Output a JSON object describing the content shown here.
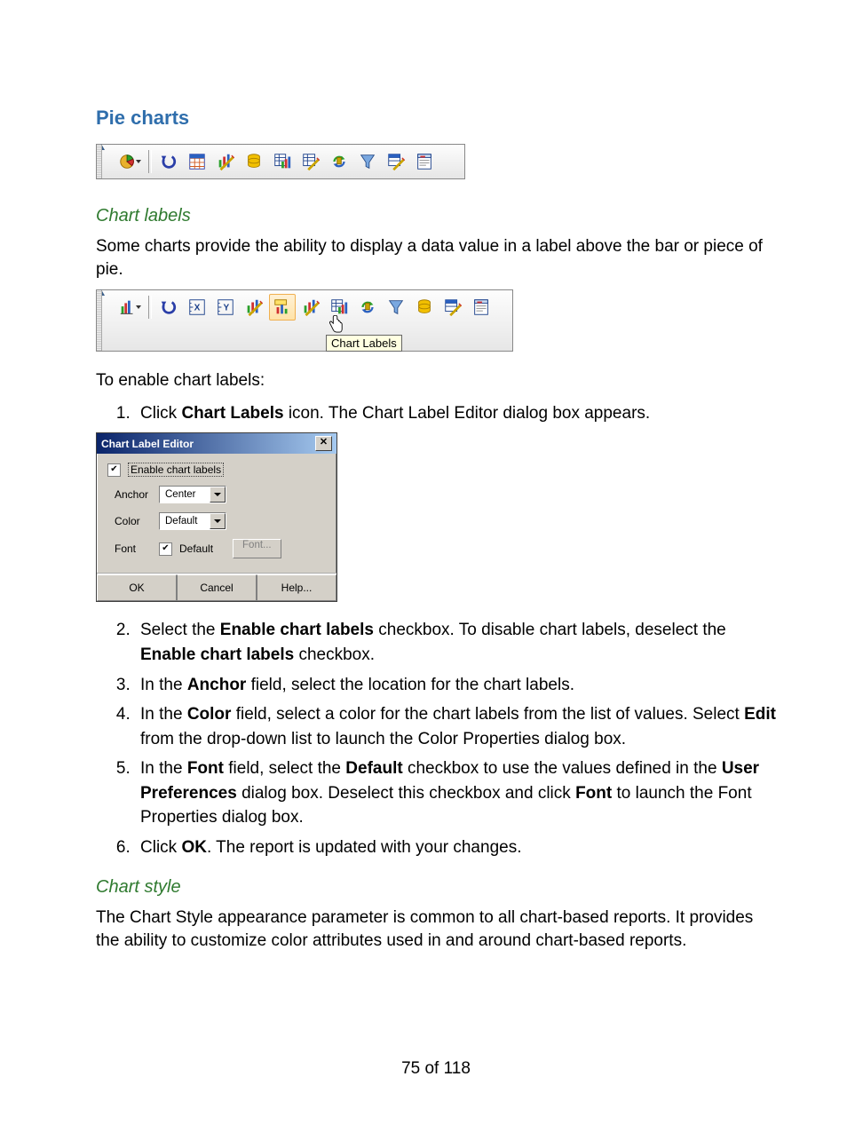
{
  "heading": "Pie charts",
  "sub_labels": "Chart labels",
  "para_labels_intro": "Some charts provide the ability to display a data value in a label above the bar or piece of pie.",
  "para_enable_labels": "To enable chart labels:",
  "tb1": {
    "items": [
      "pie-chart-icon",
      "undo-icon",
      "table-grid-icon",
      "graph-edit-icon",
      "database-icon",
      "data-grid-icon",
      "data-edit-icon",
      "refresh-icon",
      "filter-icon",
      "table-edit-icon",
      "page-layout-icon"
    ]
  },
  "tb2": {
    "items": [
      "bar-chart-icon",
      "undo-icon",
      "axis-x-icon",
      "axis-y-icon",
      "graph-edit-icon",
      "chart-labels-icon",
      "graph-edit2-icon",
      "data-grid-icon",
      "refresh-icon",
      "filter-icon",
      "database-icon",
      "table-edit-icon",
      "page-layout-icon"
    ],
    "tooltip": "Chart Labels"
  },
  "step1_a": "Click ",
  "step1_b": "Chart Labels",
  "step1_c": " icon. The Chart Label Editor dialog box appears.",
  "dialog": {
    "title": "Chart Label Editor",
    "enable_label": "Enable chart labels",
    "enable_checked": true,
    "anchor_label": "Anchor",
    "anchor_value": "Center",
    "color_label": "Color",
    "color_value": "Default",
    "font_label": "Font",
    "font_default_label": "Default",
    "font_default_checked": true,
    "font_btn": "Font...",
    "ok": "OK",
    "cancel": "Cancel",
    "help": "Help..."
  },
  "step2_a": "Select the ",
  "step2_b": "Enable chart labels",
  "step2_c": " checkbox. To disable chart labels, deselect the ",
  "step2_d": "Enable chart labels",
  "step2_e": " checkbox.",
  "step3_a": "In the ",
  "step3_b": "Anchor",
  "step3_c": " field, select the location for the chart labels.",
  "step4_a": "In the ",
  "step4_b": "Color",
  "step4_c": " field, select a color for the chart labels from the list of values. Select ",
  "step4_d": "Edit",
  "step4_e": " from the drop-down list to launch the Color Properties dialog box.",
  "step5_a": "In the ",
  "step5_b": "Font",
  "step5_c": " field, select the ",
  "step5_d": "Default",
  "step5_e": " checkbox to use the values defined in the ",
  "step5_f": "User Preferences",
  "step5_g": " dialog box. Deselect this checkbox and click ",
  "step5_h": "Font",
  "step5_i": " to launch the Font Properties dialog box.",
  "step6_a": "Click ",
  "step6_b": "OK",
  "step6_c": ". The report is updated with your changes.",
  "sub_style": "Chart style",
  "para_style": "The Chart Style appearance parameter is common to all chart-based reports. It provides the ability to customize color attributes used in and around chart-based reports.",
  "footer": "75 of 118"
}
